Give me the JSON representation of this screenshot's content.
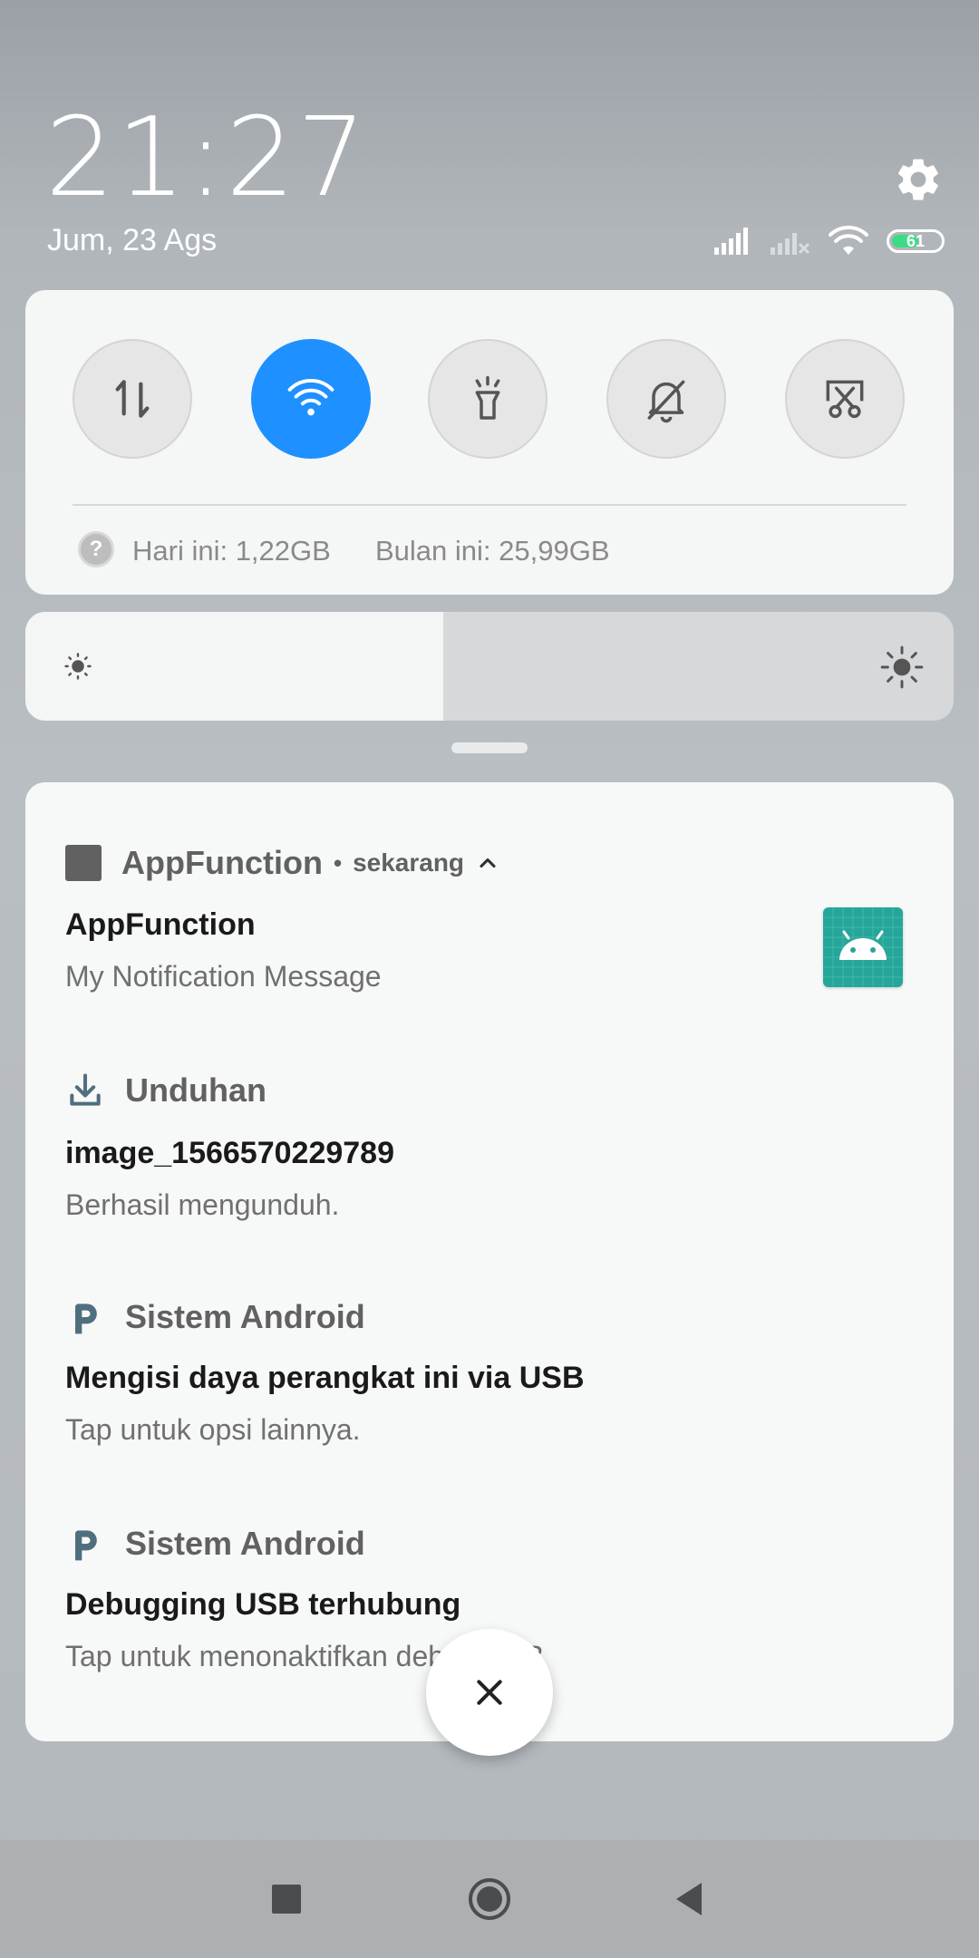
{
  "header": {
    "time": "21:27",
    "date": "Jum, 23 Ags",
    "battery_level": "61"
  },
  "quick_settings": {
    "toggles": [
      {
        "name": "mobile-data",
        "icon": "data-transfer-icon",
        "active": false
      },
      {
        "name": "wifi",
        "icon": "wifi-icon",
        "active": true
      },
      {
        "name": "flashlight",
        "icon": "flashlight-icon",
        "active": false
      },
      {
        "name": "silent",
        "icon": "bell-off-icon",
        "active": false
      },
      {
        "name": "screenshot",
        "icon": "screenshot-icon",
        "active": false
      }
    ],
    "data_today": "Hari ini: 1,22GB",
    "data_month": "Bulan ini: 25,99GB"
  },
  "brightness": {
    "level": 0.45
  },
  "notifications": [
    {
      "app": "AppFunction",
      "time": "sekarang",
      "title": "AppFunction",
      "text": "My Notification Message",
      "icon": "app-square-icon"
    },
    {
      "app": "Unduhan",
      "title": "image_1566570229789",
      "text": "Berhasil mengunduh.",
      "icon": "download-icon"
    },
    {
      "app": "Sistem Android",
      "title": "Mengisi daya perangkat ini via USB",
      "text": "Tap untuk opsi lainnya.",
      "icon": "android-system-icon"
    },
    {
      "app": "Sistem Android",
      "title": "Debugging USB terhubung",
      "text": "Tap untuk menonaktifkan debug USB",
      "icon": "android-system-icon"
    }
  ],
  "colors": {
    "accent": "#1e90ff",
    "battery": "#3ddc84",
    "thumb": "#26a69a"
  }
}
